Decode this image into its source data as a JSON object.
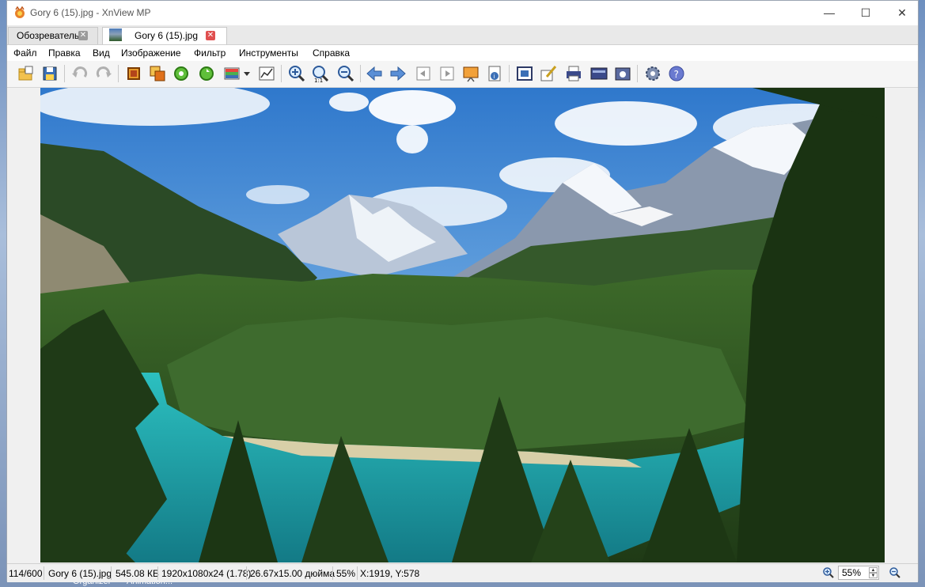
{
  "window": {
    "title": "Gory 6 (15).jpg - XnView MP",
    "minimize_glyph": "—",
    "maximize_glyph": "☐",
    "close_glyph": "✕"
  },
  "tabs": [
    {
      "label": "Обозреватель",
      "close_glyph": "✕"
    },
    {
      "label": "Gory 6 (15).jpg",
      "close_glyph": "✕"
    }
  ],
  "menu": [
    "Файл",
    "Правка",
    "Вид",
    "Изображение",
    "Фильтр",
    "Инструменты",
    "Справка"
  ],
  "toolbar_icons": [
    "browser-folder-icon",
    "save-icon",
    "undo-icon",
    "redo-icon",
    "crop-icon",
    "resize-icon",
    "rotate-left-icon",
    "rotate-right-icon",
    "adjust-colors-icon",
    "dropdown-arrow-icon",
    "levels-icon",
    "zoom-in-icon",
    "zoom-1to1-icon",
    "zoom-out-icon",
    "previous-icon",
    "next-icon",
    "first-icon",
    "last-icon",
    "slideshow-icon",
    "info-icon",
    "fit-window-icon",
    "edit-icon",
    "print-icon",
    "fullscreen-icon",
    "screenshot-icon",
    "settings-icon",
    "help-icon"
  ],
  "status": {
    "index": "114/600",
    "filename": "Gory 6 (15).jpg",
    "filesize": "545.08 КБ",
    "dimensions": "1920x1080x24 (1.78)",
    "print_size": "26.67x15.00 дюйма",
    "zoom_percent": "55%",
    "coords": "X:1919, Y:578",
    "zoom_value": "55%"
  },
  "desktop": {
    "labels": [
      "Organizer",
      "Animation..."
    ]
  },
  "colors": {
    "sky": "#3f86d4",
    "forest": "#2e4f22",
    "lake": "#1fa3a6",
    "accent_close": "#e05050"
  }
}
